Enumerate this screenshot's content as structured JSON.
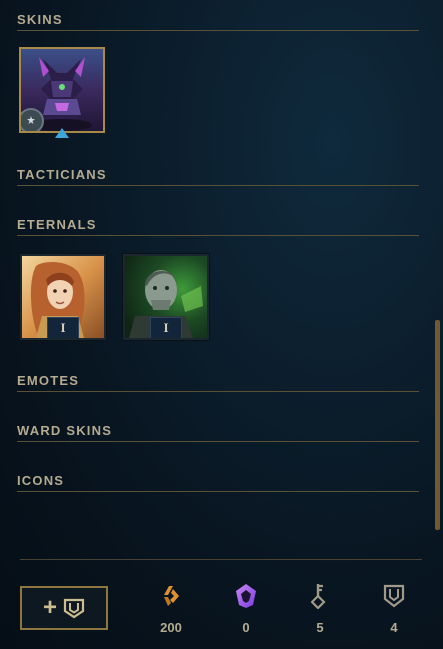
{
  "sections": {
    "skins": {
      "label": "SKINS"
    },
    "tacticians": {
      "label": "TACTICIANS"
    },
    "eternals": {
      "label": "ETERNALS"
    },
    "emotes": {
      "label": "EMOTES"
    },
    "ward_skins": {
      "label": "WARD SKINS"
    },
    "icons": {
      "label": "ICONS"
    }
  },
  "skins": [
    {
      "icon": "skin-portrait",
      "badge_icon": "gear-emblem-icon",
      "marker_icon": "blue-triangle-icon"
    }
  ],
  "eternals": [
    {
      "icon": "eternal-portrait-1",
      "tier": "I"
    },
    {
      "icon": "eternal-portrait-2",
      "tier": "I"
    }
  ],
  "footer": {
    "add_button_icon": "plus-shield-icon",
    "add_button_plus": "+",
    "currencies": [
      {
        "icon": "orange-essence-icon",
        "value": "200",
        "color": "#e0912f"
      },
      {
        "icon": "mythic-essence-icon",
        "value": "0",
        "color": "#9b5ff0"
      },
      {
        "icon": "key-icon",
        "value": "5",
        "color": "#a09a88"
      },
      {
        "icon": "shield-chest-icon",
        "value": "4",
        "color": "#a09a88"
      }
    ]
  }
}
